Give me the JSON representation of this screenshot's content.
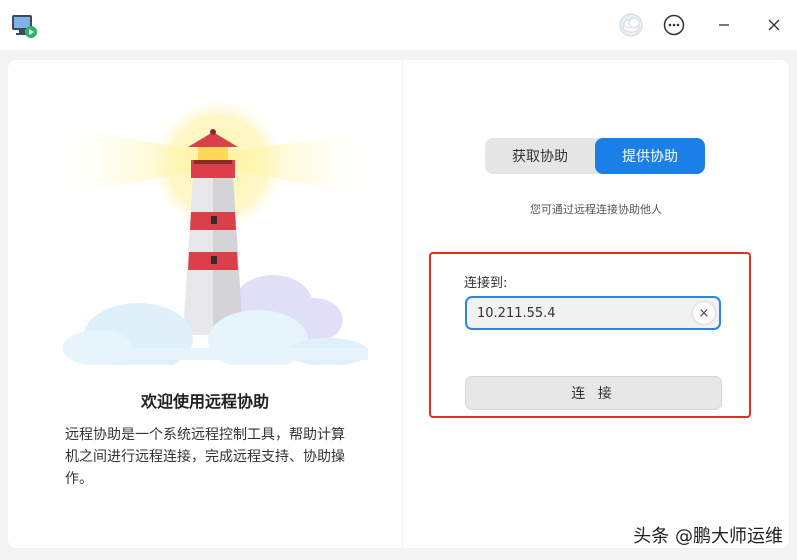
{
  "titlebar": {
    "app_icon": "remote-assistance-app-icon",
    "avatar_icon": "cloud-avatar-icon",
    "menu_icon": "more-menu-icon",
    "minimize_icon": "minimize-icon",
    "close_icon": "close-icon"
  },
  "left": {
    "illustration": "lighthouse-illustration",
    "title": "欢迎使用远程协助",
    "description": "远程协助是一个系统远程控制工具，帮助计算机之间进行远程连接，完成远程支持、协助操作。"
  },
  "right": {
    "tabs": [
      {
        "label": "获取协助",
        "active": false
      },
      {
        "label": "提供协助",
        "active": true
      }
    ],
    "hint": "您可通过远程连接协助他人",
    "connect_label": "连接到:",
    "ip_value": "10.211.55.4",
    "clear_icon": "clear-icon",
    "clear_glyph": "×",
    "connect_button": "连 接"
  },
  "watermark": "头条 @鹏大师运维",
  "colors": {
    "accent": "#1a7fe6",
    "highlight_border": "#e0301e"
  }
}
